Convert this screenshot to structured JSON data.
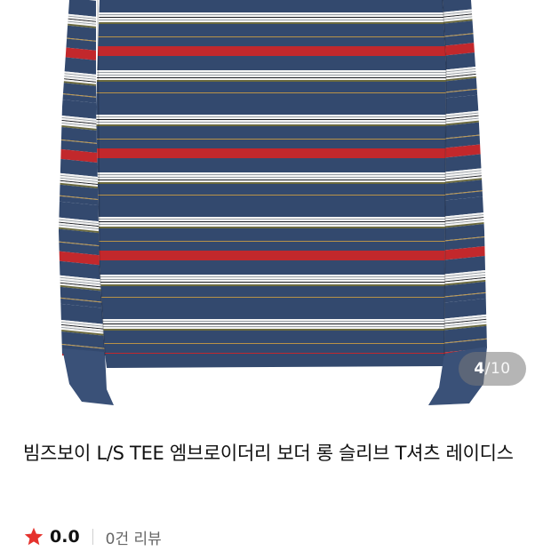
{
  "gallery": {
    "current": "4",
    "separator": "/",
    "total": "10",
    "colors": {
      "navy": "#33496e",
      "red": "#c2282c",
      "white": "#f4f4f4",
      "gray": "#9aa0a6",
      "olive": "#6b6a3e",
      "gold": "#b89248",
      "black": "#1f2126"
    }
  },
  "product": {
    "title": "빔즈보이 L/S TEE 엠브로이더리 보더 롱 슬리브 T셔츠 레이디스"
  },
  "rating": {
    "score": "0.0",
    "reviews": "0건 리뷰",
    "star_color": "#e5322d"
  }
}
